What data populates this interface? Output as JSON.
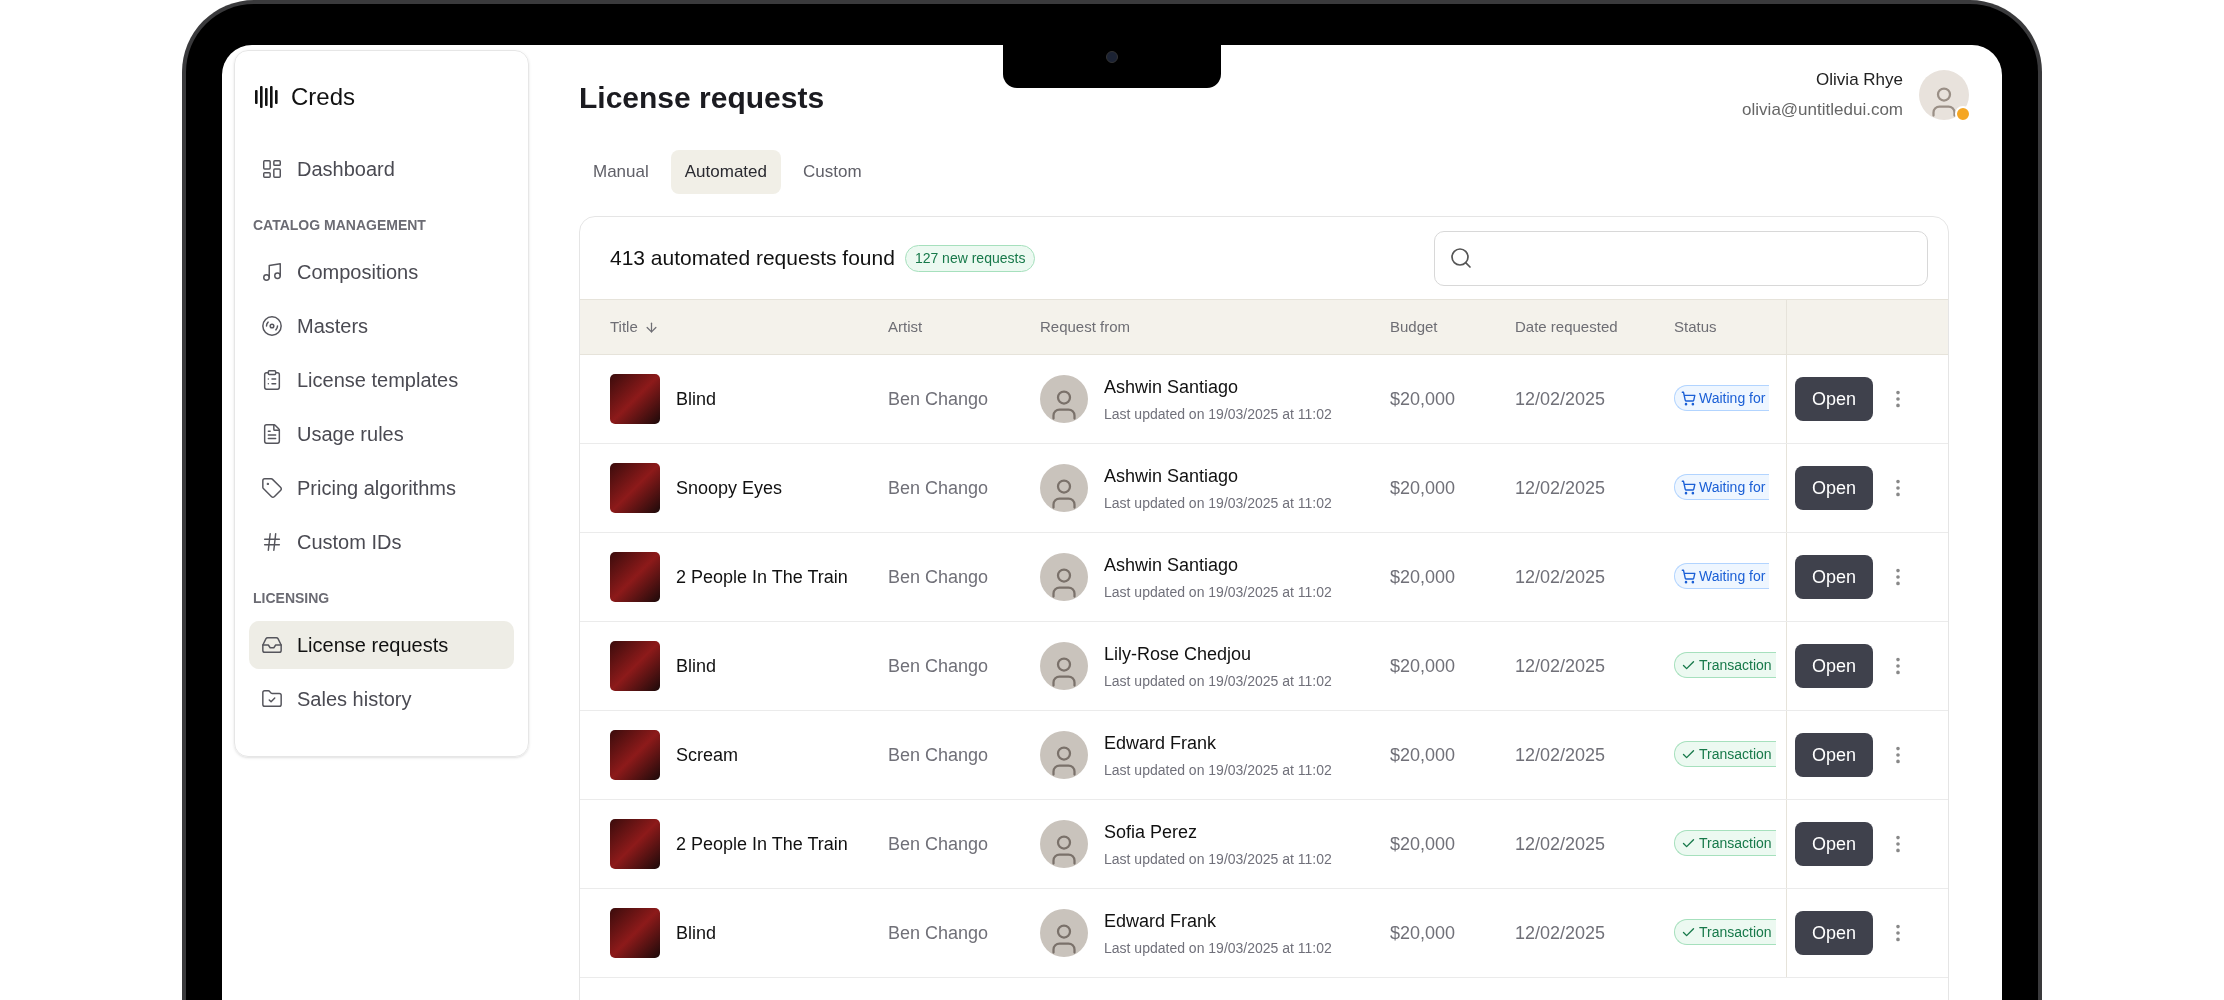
{
  "app": {
    "name": "Creds"
  },
  "sidebar": {
    "groups": [
      {
        "items": [
          {
            "label": "Dashboard",
            "selected": false
          }
        ]
      },
      {
        "heading": "CATALOG MANAGEMENT",
        "items": [
          {
            "label": "Compositions",
            "selected": false
          },
          {
            "label": "Masters",
            "selected": false
          },
          {
            "label": "License templates",
            "selected": false
          },
          {
            "label": "Usage rules",
            "selected": false
          },
          {
            "label": "Pricing algorithms",
            "selected": false
          },
          {
            "label": "Custom IDs",
            "selected": false
          }
        ]
      },
      {
        "heading": "LICENSING",
        "items": [
          {
            "label": "License requests",
            "selected": true
          },
          {
            "label": "Sales history",
            "selected": false
          }
        ]
      }
    ]
  },
  "page": {
    "title": "License requests"
  },
  "user": {
    "name": "Olivia Rhye",
    "email": "olivia@untitledui.com"
  },
  "tabs": [
    {
      "label": "Manual",
      "selected": false
    },
    {
      "label": "Automated",
      "selected": true
    },
    {
      "label": "Custom",
      "selected": false
    }
  ],
  "table": {
    "summary": "413 automated requests found",
    "badge": "127 new requests",
    "columns": [
      "Title",
      "Artist",
      "Request from",
      "Budget",
      "Date requested",
      "Status"
    ],
    "rows": [
      {
        "title": "Blind",
        "artist": "Ben Chango",
        "requester": "Ashwin Santiago",
        "updated": "Last updated on 19/03/2025 at 11:02",
        "budget": "$20,000",
        "date": "12/02/2025",
        "status": {
          "kind": "waiting",
          "label": "Waiting for"
        },
        "action": "Open"
      },
      {
        "title": "Snoopy Eyes",
        "artist": "Ben Chango",
        "requester": "Ashwin Santiago",
        "updated": "Last updated on 19/03/2025 at 11:02",
        "budget": "$20,000",
        "date": "12/02/2025",
        "status": {
          "kind": "waiting",
          "label": "Waiting for"
        },
        "action": "Open"
      },
      {
        "title": "2 People In The Train",
        "artist": "Ben Chango",
        "requester": "Ashwin Santiago",
        "updated": "Last updated on 19/03/2025 at 11:02",
        "budget": "$20,000",
        "date": "12/02/2025",
        "status": {
          "kind": "waiting",
          "label": "Waiting for"
        },
        "action": "Open"
      },
      {
        "title": "Blind",
        "artist": "Ben Chango",
        "requester": "Lily-Rose Chedjou",
        "updated": "Last updated on 19/03/2025 at 11:02",
        "budget": "$20,000",
        "date": "12/02/2025",
        "status": {
          "kind": "done",
          "label": "Transaction"
        },
        "action": "Open"
      },
      {
        "title": "Scream",
        "artist": "Ben Chango",
        "requester": "Edward Frank",
        "updated": "Last updated on 19/03/2025 at 11:02",
        "budget": "$20,000",
        "date": "12/02/2025",
        "status": {
          "kind": "done",
          "label": "Transaction"
        },
        "action": "Open"
      },
      {
        "title": "2 People In The Train",
        "artist": "Ben Chango",
        "requester": "Sofia Perez",
        "updated": "Last updated on 19/03/2025 at 11:02",
        "budget": "$20,000",
        "date": "12/02/2025",
        "status": {
          "kind": "done",
          "label": "Transaction"
        },
        "action": "Open"
      },
      {
        "title": "Blind",
        "artist": "Ben Chango",
        "requester": "Edward Frank",
        "updated": "Last updated on 19/03/2025 at 11:02",
        "budget": "$20,000",
        "date": "12/02/2025",
        "status": {
          "kind": "done",
          "label": "Transaction"
        },
        "action": "Open"
      }
    ]
  }
}
